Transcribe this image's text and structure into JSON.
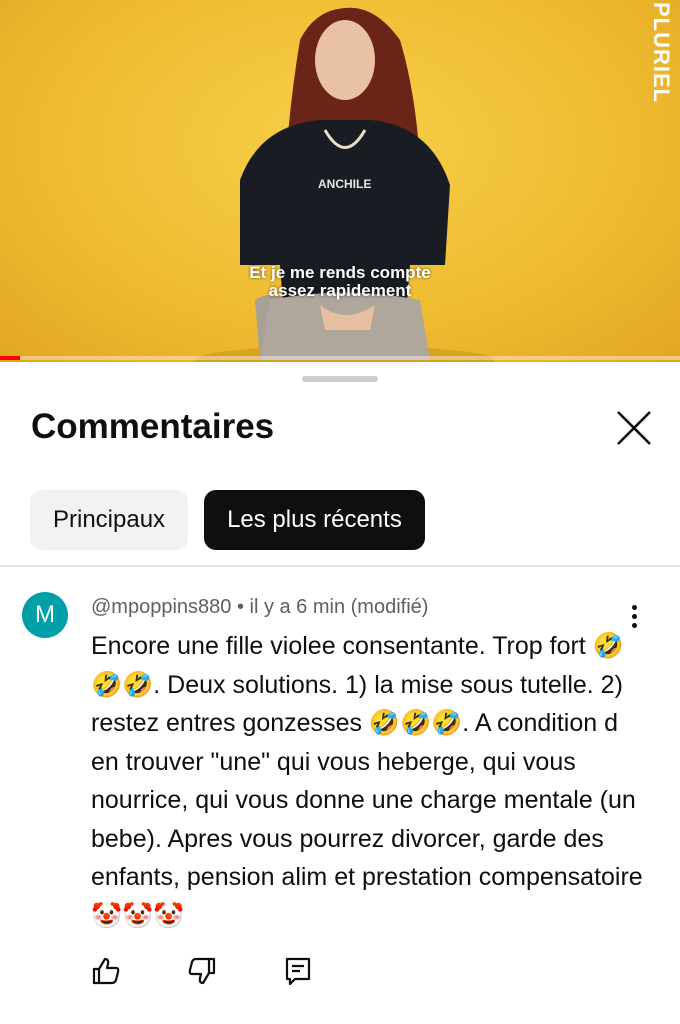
{
  "video": {
    "channel_logo": "PLURIEL",
    "subtitle_line1": "Et je me rends compte",
    "subtitle_line2": "assez rapidement",
    "shirt_text": "ANCHILE",
    "progress": 0.03
  },
  "sheet": {
    "title": "Commentaires",
    "close_icon": "close-icon"
  },
  "filters": [
    {
      "label": "Principaux",
      "selected": false
    },
    {
      "label": "Les plus récents",
      "selected": true
    }
  ],
  "comment": {
    "avatar_letter": "M",
    "avatar_color": "#00a0a8",
    "meta": "@mpoppins880 • il y a 6 min (modifié)",
    "text": "Encore une fille violee consentante. Trop fort 🤣🤣🤣. Deux solutions. 1) la mise sous tutelle. 2) restez entres gonzesses 🤣🤣🤣. A condition d en trouver \"une\" qui vous heberge, qui vous nourrice, qui vous donne une charge mentale (un bebe). Apres vous pourrez divorcer, garde des enfants, pension alim et prestation compensatoire 🤡🤡🤡",
    "actions": [
      "like-icon",
      "dislike-icon",
      "reply-icon"
    ]
  }
}
